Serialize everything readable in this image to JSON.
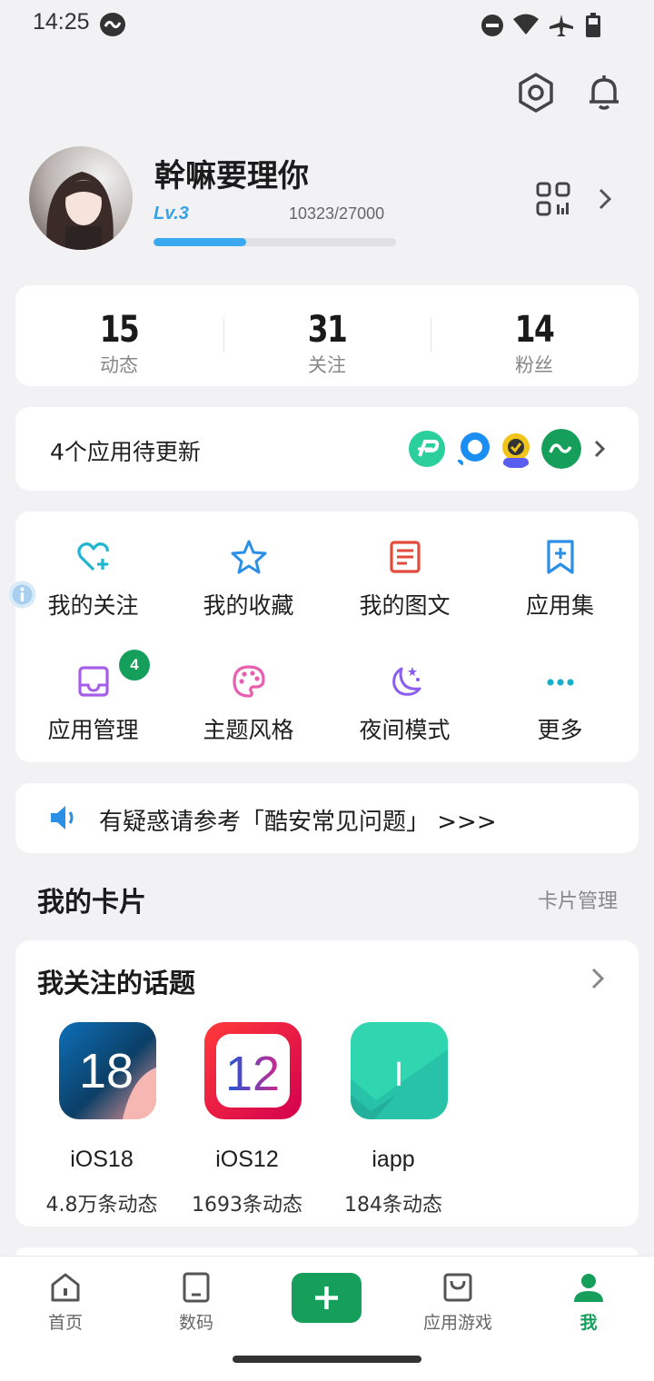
{
  "status_bar": {
    "time": "14:25"
  },
  "profile": {
    "username": "幹嘛要理你",
    "level": "Lv.3",
    "exp": "10323/27000",
    "exp_progress": 0.382
  },
  "stats": [
    {
      "value": "15",
      "label": "动态"
    },
    {
      "value": "31",
      "label": "关注"
    },
    {
      "value": "14",
      "label": "粉丝"
    }
  ],
  "updates": {
    "text": "4个应用待更新"
  },
  "grid": [
    {
      "label": "我的关注",
      "icon": "heart-plus-icon",
      "color": "#20b6cf"
    },
    {
      "label": "我的收藏",
      "icon": "star-icon",
      "color": "#2c8fe6"
    },
    {
      "label": "我的图文",
      "icon": "document-icon",
      "color": "#e44b3b"
    },
    {
      "label": "应用集",
      "icon": "bookmark-plus-icon",
      "color": "#2c8fe6"
    },
    {
      "label": "应用管理",
      "icon": "inbox-icon",
      "color": "#a65ee8",
      "badge": "4"
    },
    {
      "label": "主题风格",
      "icon": "palette-icon",
      "color": "#e85fb0"
    },
    {
      "label": "夜间模式",
      "icon": "moon-stars-icon",
      "color": "#8a5cf0"
    },
    {
      "label": "更多",
      "icon": "more-icon",
      "color": "#17b0c9"
    }
  ],
  "notice": {
    "text": "有疑惑请参考「酷安常见问题」 >>>"
  },
  "cards_section": {
    "title": "我的卡片",
    "manage": "卡片管理"
  },
  "topics_card": {
    "title": "我关注的话题",
    "items": [
      {
        "name": "iOS18",
        "count": "4.8万条动态",
        "badge_text": "18"
      },
      {
        "name": "iOS12",
        "count": "1693条动态",
        "badge_text": "12"
      },
      {
        "name": "iapp",
        "count": "184条动态",
        "badge_text": "I"
      }
    ]
  },
  "bottom_nav": [
    {
      "label": "首页",
      "icon": "home-icon"
    },
    {
      "label": "数码",
      "icon": "phone-icon"
    },
    {
      "label": "",
      "icon": "plus-icon"
    },
    {
      "label": "应用游戏",
      "icon": "shopping-bag-icon"
    },
    {
      "label": "我",
      "icon": "user-icon",
      "active": true
    }
  ],
  "colors": {
    "accent": "#169e5b",
    "level": "#36a3e6",
    "background": "#f2f2f4"
  }
}
